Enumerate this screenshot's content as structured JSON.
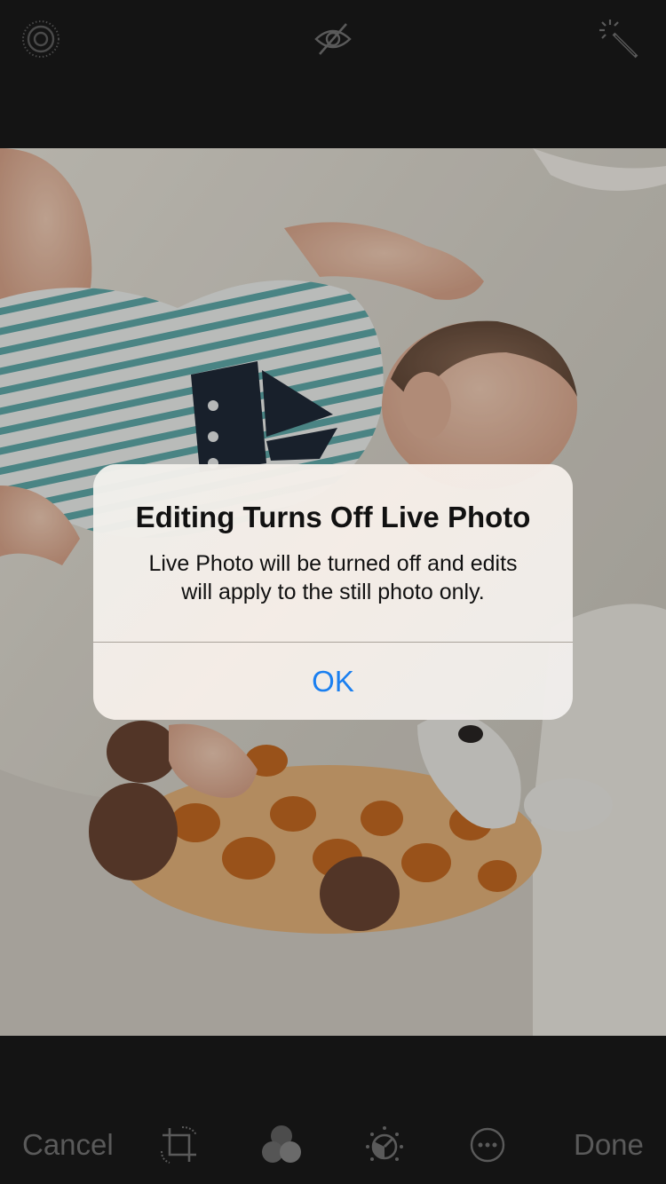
{
  "top_bar": {
    "live_photo_icon": "live-photo-icon",
    "hidden_icon": "eye-slash-icon",
    "auto_enhance_icon": "magic-wand-icon"
  },
  "alert": {
    "title": "Editing Turns Off Live Photo",
    "message_line1": "Live Photo will be turned off and edits",
    "message_line2": "will apply to the still photo only.",
    "ok_label": "OK"
  },
  "toolbar": {
    "cancel_label": "Cancel",
    "done_label": "Done",
    "tools": [
      "crop-rotate-icon",
      "filters-icon",
      "adjust-icon",
      "more-icon"
    ]
  },
  "colors": {
    "accent": "#1a7ff0",
    "background": "#141414",
    "disabled_text": "#5a5a5a"
  }
}
